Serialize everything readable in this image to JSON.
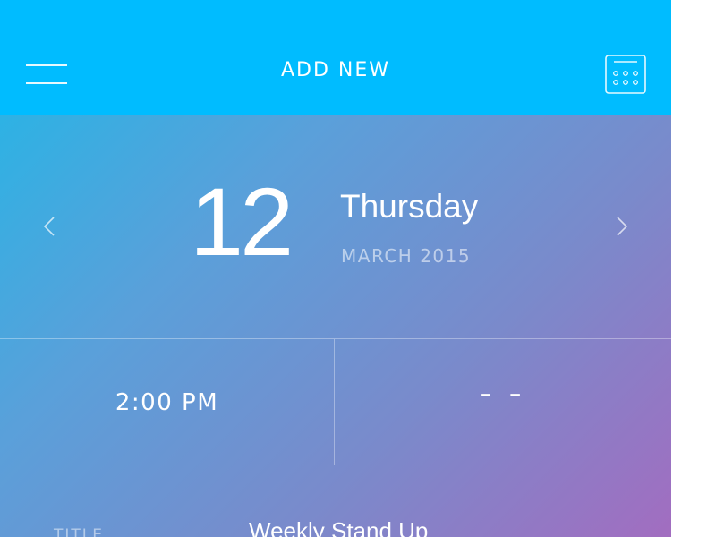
{
  "header": {
    "title": "ADD NEW",
    "background_color": "#00bcff",
    "menu_icon": "hamburger-menu-icon",
    "calendar_icon": "calendar-icon"
  },
  "date": {
    "day": "12",
    "weekday": "Thursday",
    "month_year": "MARCH 2015",
    "prev_icon": "chevron-left-icon",
    "next_icon": "chevron-right-icon"
  },
  "time": {
    "start": "2:00 PM",
    "end": "– –"
  },
  "form": {
    "title_label": "TITLE",
    "title_value": "Weekly Stand Up"
  },
  "colors": {
    "gradient_start": "#2db2e4",
    "gradient_end": "#a26dc0"
  }
}
